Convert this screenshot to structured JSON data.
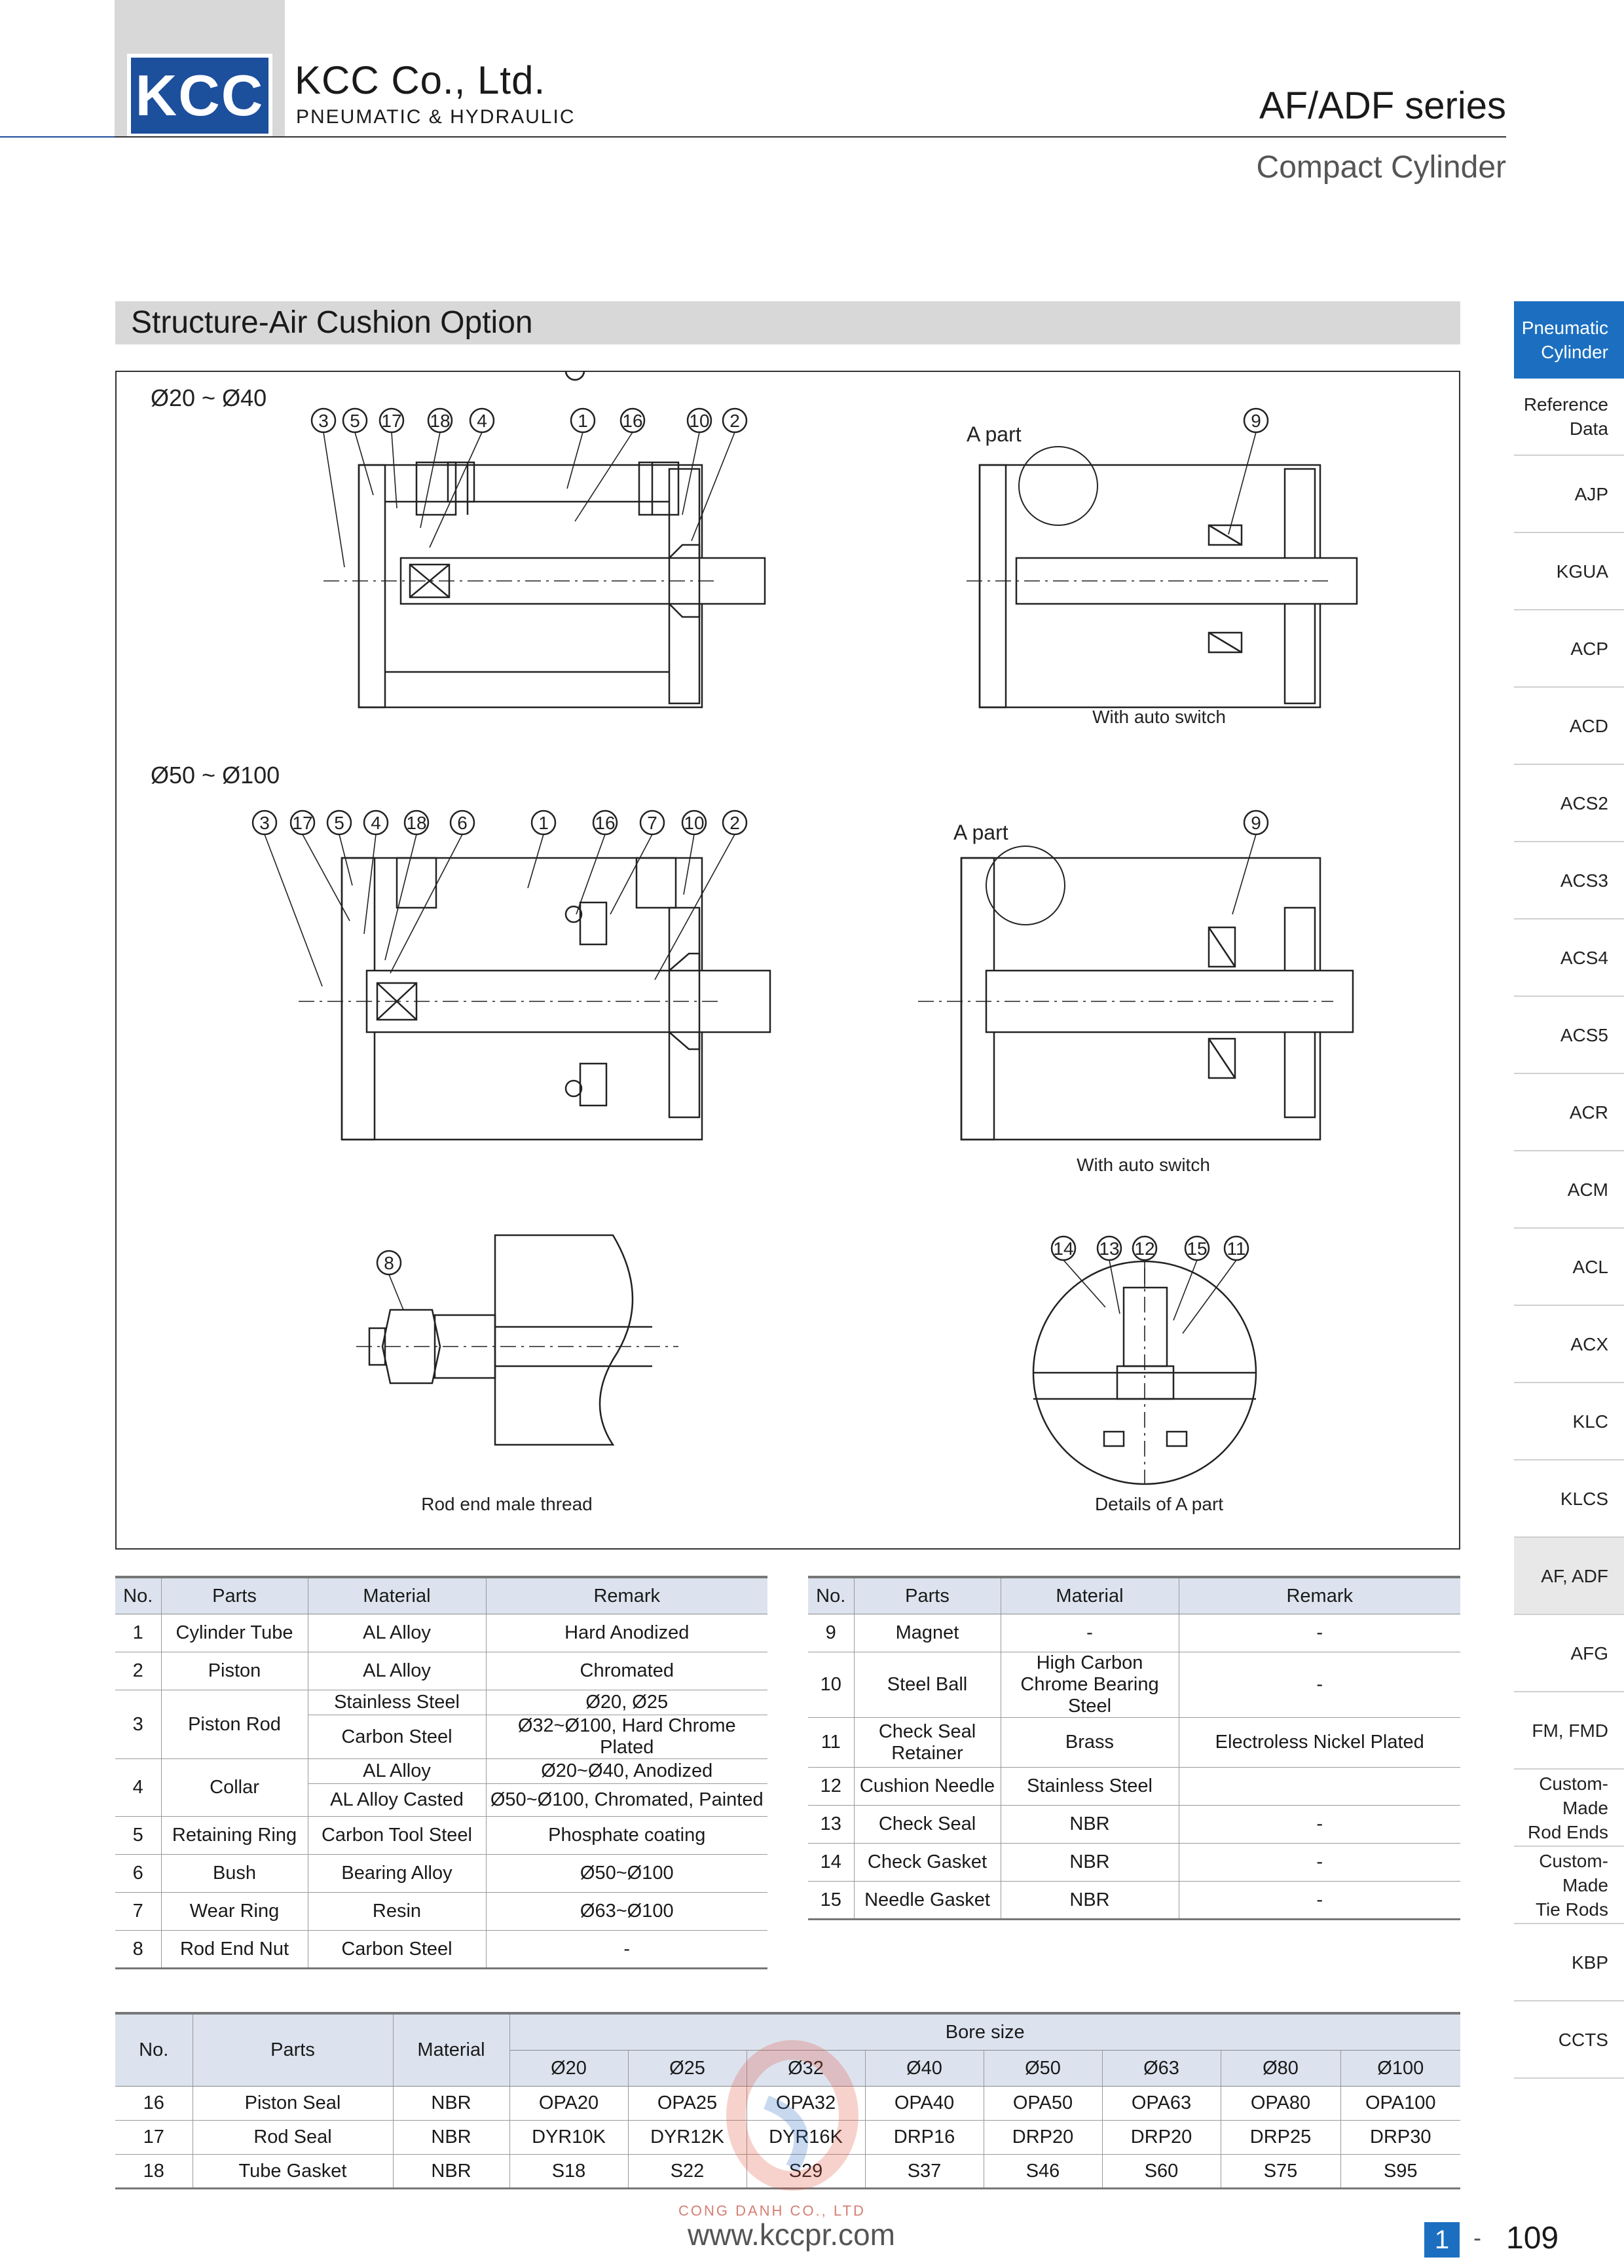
{
  "header": {
    "logo_text": "KCC",
    "company_name": "KCC Co., Ltd.",
    "company_sub": "PNEUMATIC & HYDRAULIC",
    "series_title": "AF/ADF series",
    "series_sub": "Compact Cylinder"
  },
  "section": {
    "title": "Structure-Air Cushion Option"
  },
  "drawings": {
    "range_small": "Ø20 ~ Ø40",
    "range_large": "Ø50 ~ Ø100",
    "a_part_1": "A part",
    "a_part_2": "A part",
    "caption_auto_1": "With auto switch",
    "caption_auto_2": "With auto switch",
    "caption_rod_end": "Rod end male thread",
    "caption_detail": "Details of A part",
    "callouts_small": [
      "3",
      "5",
      "17",
      "18",
      "4",
      "1",
      "16",
      "10",
      "2"
    ],
    "callouts_large": [
      "3",
      "17",
      "5",
      "4",
      "18",
      "6",
      "1",
      "16",
      "7",
      "10",
      "2"
    ],
    "callout_9a": "9",
    "callout_9b": "9",
    "callout_8": "8",
    "callouts_detail": [
      "14",
      "13",
      "12",
      "15",
      "11"
    ]
  },
  "sidebar": {
    "items": [
      {
        "label": "Pneumatic\nCylinder",
        "active": true
      },
      {
        "label": "Reference\nData"
      },
      {
        "label": "AJP"
      },
      {
        "label": "KGUA"
      },
      {
        "label": "ACP"
      },
      {
        "label": "ACD"
      },
      {
        "label": "ACS2"
      },
      {
        "label": "ACS3"
      },
      {
        "label": "ACS4"
      },
      {
        "label": "ACS5"
      },
      {
        "label": "ACR"
      },
      {
        "label": "ACM"
      },
      {
        "label": "ACL"
      },
      {
        "label": "ACX"
      },
      {
        "label": "KLC"
      },
      {
        "label": "KLCS"
      },
      {
        "label": "AF, ADF",
        "current": true
      },
      {
        "label": "AFG"
      },
      {
        "label": "FM, FMD"
      },
      {
        "label": "Custom-\nMade\nRod Ends"
      },
      {
        "label": "Custom-\nMade\nTie Rods"
      },
      {
        "label": "KBP"
      },
      {
        "label": "CCTS"
      }
    ]
  },
  "table1": {
    "headers": [
      "No.",
      "Parts",
      "Material",
      "Remark"
    ],
    "rows": [
      {
        "no": "1",
        "part": "Cylinder Tube",
        "material": "AL Alloy",
        "remark": "Hard Anodized"
      },
      {
        "no": "2",
        "part": "Piston",
        "material": "AL Alloy",
        "remark": "Chromated"
      },
      {
        "no": "3",
        "part": "Piston Rod",
        "material": "Stainless Steel",
        "remark": "Ø20, Ø25",
        "material2": "Carbon Steel",
        "remark2": "Ø32~Ø100, Hard Chrome Plated"
      },
      {
        "no": "4",
        "part": "Collar",
        "material": "AL Alloy",
        "remark": "Ø20~Ø40, Anodized",
        "material2": "AL Alloy Casted",
        "remark2": "Ø50~Ø100, Chromated, Painted"
      },
      {
        "no": "5",
        "part": "Retaining Ring",
        "material": "Carbon Tool Steel",
        "remark": "Phosphate coating"
      },
      {
        "no": "6",
        "part": "Bush",
        "material": "Bearing Alloy",
        "remark": "Ø50~Ø100"
      },
      {
        "no": "7",
        "part": "Wear Ring",
        "material": "Resin",
        "remark": "Ø63~Ø100"
      },
      {
        "no": "8",
        "part": "Rod End Nut",
        "material": "Carbon Steel",
        "remark": "-"
      }
    ]
  },
  "table2": {
    "headers": [
      "No.",
      "Parts",
      "Material",
      "Remark"
    ],
    "rows": [
      {
        "no": "9",
        "part": "Magnet",
        "material": "-",
        "remark": "-"
      },
      {
        "no": "10",
        "part": "Steel Ball",
        "material": "High Carbon Chrome Bearing Steel",
        "remark": "-"
      },
      {
        "no": "11",
        "part": "Check Seal Retainer",
        "material": "Brass",
        "remark": "Electroless Nickel Plated"
      },
      {
        "no": "12",
        "part": "Cushion Needle",
        "material": "Stainless Steel",
        "remark": ""
      },
      {
        "no": "13",
        "part": "Check Seal",
        "material": "NBR",
        "remark": "-"
      },
      {
        "no": "14",
        "part": "Check Gasket",
        "material": "NBR",
        "remark": "-"
      },
      {
        "no": "15",
        "part": "Needle Gasket",
        "material": "NBR",
        "remark": "-"
      }
    ]
  },
  "table3": {
    "headers": [
      "No.",
      "Parts",
      "Material"
    ],
    "bore_header": "Bore size",
    "bores": [
      "Ø20",
      "Ø25",
      "Ø32",
      "Ø40",
      "Ø50",
      "Ø63",
      "Ø80",
      "Ø100"
    ],
    "rows": [
      {
        "no": "16",
        "part": "Piston Seal",
        "material": "NBR",
        "values": [
          "OPA20",
          "OPA25",
          "OPA32",
          "OPA40",
          "OPA50",
          "OPA63",
          "OPA80",
          "OPA100"
        ]
      },
      {
        "no": "17",
        "part": "Rod Seal",
        "material": "NBR",
        "values": [
          "DYR10K",
          "DYR12K",
          "DYR16K",
          "DRP16",
          "DRP20",
          "DRP20",
          "DRP25",
          "DRP30"
        ]
      },
      {
        "no": "18",
        "part": "Tube Gasket",
        "material": "NBR",
        "values": [
          "S18",
          "S22",
          "S29",
          "S37",
          "S46",
          "S60",
          "S75",
          "S95"
        ]
      }
    ]
  },
  "footer": {
    "watermark_company": "CONG DANH CO., LTD",
    "url": "www.kccpr.com",
    "chapter": "1",
    "dash": "-",
    "page": "109"
  },
  "colors": {
    "brand_blue": "#1c4f9c",
    "active_blue": "#1c6fc0",
    "header_gray": "#d8d8d8",
    "table_head": "#dce3ef"
  }
}
